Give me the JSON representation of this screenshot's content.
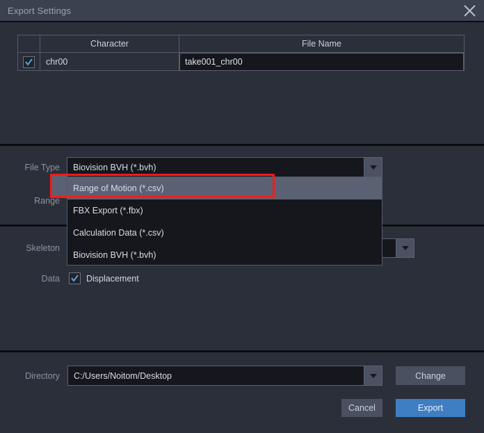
{
  "window": {
    "title": "Export Settings",
    "close_icon": "close-icon"
  },
  "character_table": {
    "columns": [
      "",
      "Character",
      "File Name"
    ],
    "rows": [
      {
        "checked": true,
        "character": "chr00",
        "file_name": "take001_chr00"
      }
    ]
  },
  "file_type": {
    "label": "File Type",
    "value": "Biovision BVH (*.bvh)",
    "dropdown_icon": "chevron-down-icon",
    "open": true,
    "options": [
      "Range of Motion (*.csv)",
      "FBX Export (*.fbx)",
      "Calculation Data (*.csv)",
      "Biovision BVH (*.bvh)"
    ],
    "highlighted_option": "Range of Motion (*.csv)"
  },
  "range": {
    "label": "Range"
  },
  "skeleton": {
    "label": "Skeleton",
    "dropdown_icon": "chevron-down-icon"
  },
  "data_row": {
    "label": "Data",
    "checkbox_label": "Displacement",
    "checked": true
  },
  "directory": {
    "label": "Directory",
    "value": "C:/Users/Noitom/Desktop",
    "dropdown_icon": "chevron-down-icon",
    "change_label": "Change"
  },
  "footer": {
    "cancel_label": "Cancel",
    "export_label": "Export"
  },
  "colors": {
    "window_bg": "#2b2f3a",
    "titlebar_bg": "#3c4150",
    "field_bg": "#15171d",
    "accent_blue": "#3e7ec2",
    "highlight_red": "#fc1a17",
    "menu_selected": "#5a6173"
  }
}
